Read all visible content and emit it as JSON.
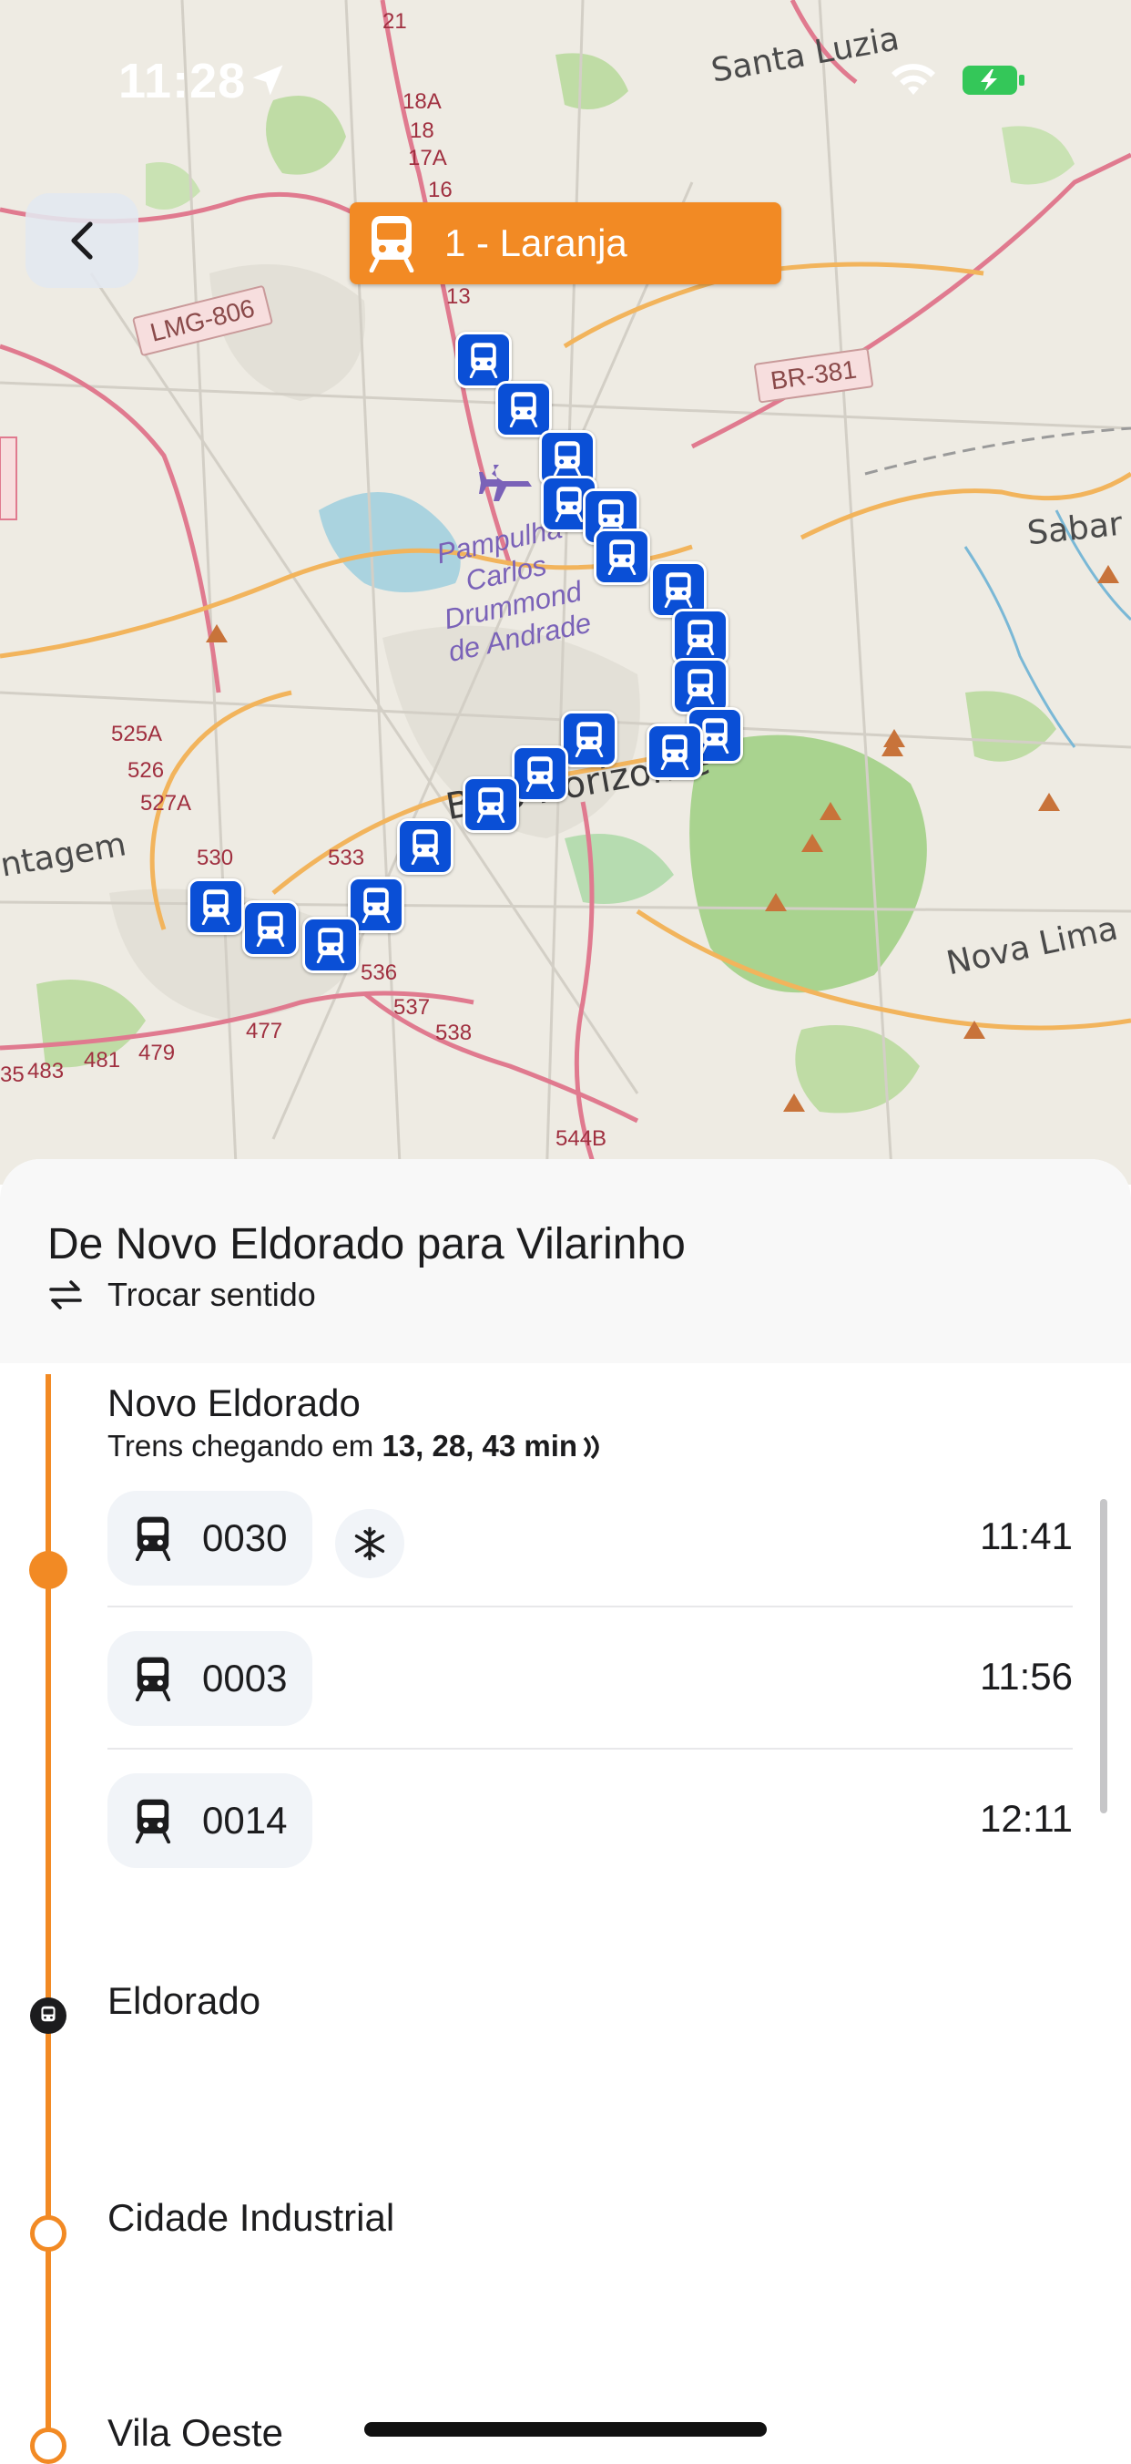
{
  "status_bar": {
    "time": "11:28"
  },
  "map": {
    "line_badge": {
      "label": "1 - Laranja",
      "color": "#f28a24"
    },
    "places": {
      "santa_luzia": "Santa Luzia",
      "sabara": "Sabar",
      "nova_lima": "Nova Lima",
      "contagem": "ntagem",
      "belo_horizonte": "Belo Horizonte"
    },
    "roads": {
      "lmg806": "LMG-806",
      "br381": "BR-381"
    },
    "lake_label": [
      "Pampulha",
      "Carlos",
      "Drummond",
      "de Andrade"
    ],
    "route_numbers": [
      "21",
      "18A",
      "18",
      "17A",
      "16",
      "13",
      "525A",
      "526",
      "527A",
      "530",
      "533",
      "536",
      "537",
      "538",
      "544B",
      "483",
      "481",
      "479",
      "477",
      "35"
    ],
    "marker_color": "#0a4fd6"
  },
  "sheet": {
    "direction_title": "De Novo Eldorado para Vilarinho",
    "swap_label": "Trocar sentido"
  },
  "stations": [
    {
      "name": "Novo Eldorado",
      "arrivals_prefix": "Trens chegando em",
      "arrivals_values": "13, 28, 43 min",
      "trains": [
        {
          "number": "0030",
          "time": "11:41",
          "air_conditioned": true
        },
        {
          "number": "0003",
          "time": "11:56",
          "air_conditioned": false
        },
        {
          "number": "0014",
          "time": "12:11",
          "air_conditioned": false
        }
      ]
    },
    {
      "name": "Eldorado"
    },
    {
      "name": "Cidade Industrial"
    },
    {
      "name": "Vila Oeste"
    }
  ],
  "colors": {
    "accent": "#f28a24",
    "marker": "#0a4fd6"
  }
}
